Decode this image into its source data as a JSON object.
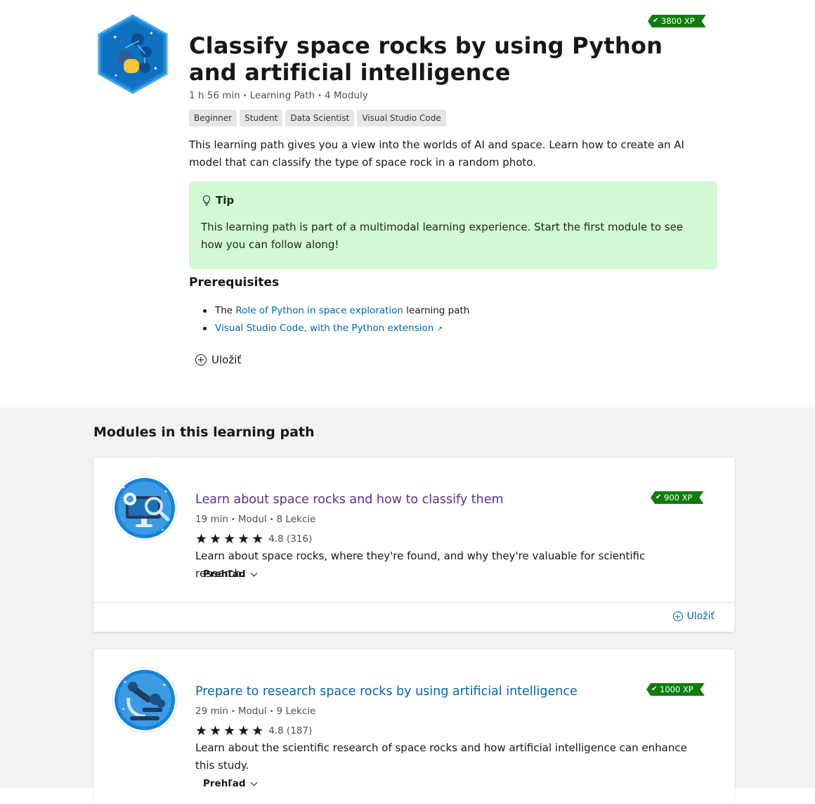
{
  "header": {
    "xp": "3800 XP",
    "title": "Classify space rocks by using Python and artificial intelligence",
    "meta": {
      "duration": "1 h 56 min",
      "type": "Learning Path",
      "modules": "4 Moduly"
    },
    "tags": [
      "Beginner",
      "Student",
      "Data Scientist",
      "Visual Studio Code"
    ],
    "description": "This learning path gives you a view into the worlds of AI and space. Learn how to create an AI model that can classify the type of space rock in a random photo."
  },
  "tip": {
    "title": "Tip",
    "body": "This learning path is part of a multimodal learning experience. Start the first module to see how you can follow along!"
  },
  "prerequisites": {
    "heading": "Prerequisites",
    "item1": {
      "prefix": "The",
      "link": "Role of Python in space exploration",
      "suffix": "learning path"
    },
    "item2": {
      "link": "Visual Studio Code, with the Python extension"
    }
  },
  "save_label": "Uložiť",
  "modules_heading": "Modules in this learning path",
  "modules": [
    {
      "xp": "900 XP",
      "title": "Learn about space rocks and how to classify them",
      "duration": "19 min",
      "type": "Modul",
      "units": "8 Lekcie",
      "rating_value": 4.8,
      "rating_text": "4.8 (316)",
      "description": "Learn about space rocks, where they're found, and why they're valuable for scientific research.",
      "overview": "Prehľad",
      "save": "Uložiť"
    },
    {
      "xp": "1000 XP",
      "title": "Prepare to research space rocks by using artificial intelligence",
      "duration": "29 min",
      "type": "Modul",
      "units": "9 Lekcie",
      "rating_value": 4.8,
      "rating_text": "4.8 (187)",
      "description": "Learn about the scientific research of space rocks and how artificial intelligence can enhance this study.",
      "overview": "Prehľad"
    }
  ],
  "colors": {
    "accent": "#0065b3",
    "visited": "#5c2e91",
    "xp_green": "#107c10",
    "tip_bg": "#d3f8d3"
  },
  "icons": [
    "learning-path-badge",
    "checkmark-icon",
    "lightbulb-icon",
    "external-link-icon",
    "plus-circle-icon",
    "star-icon",
    "chevron-down-icon"
  ]
}
